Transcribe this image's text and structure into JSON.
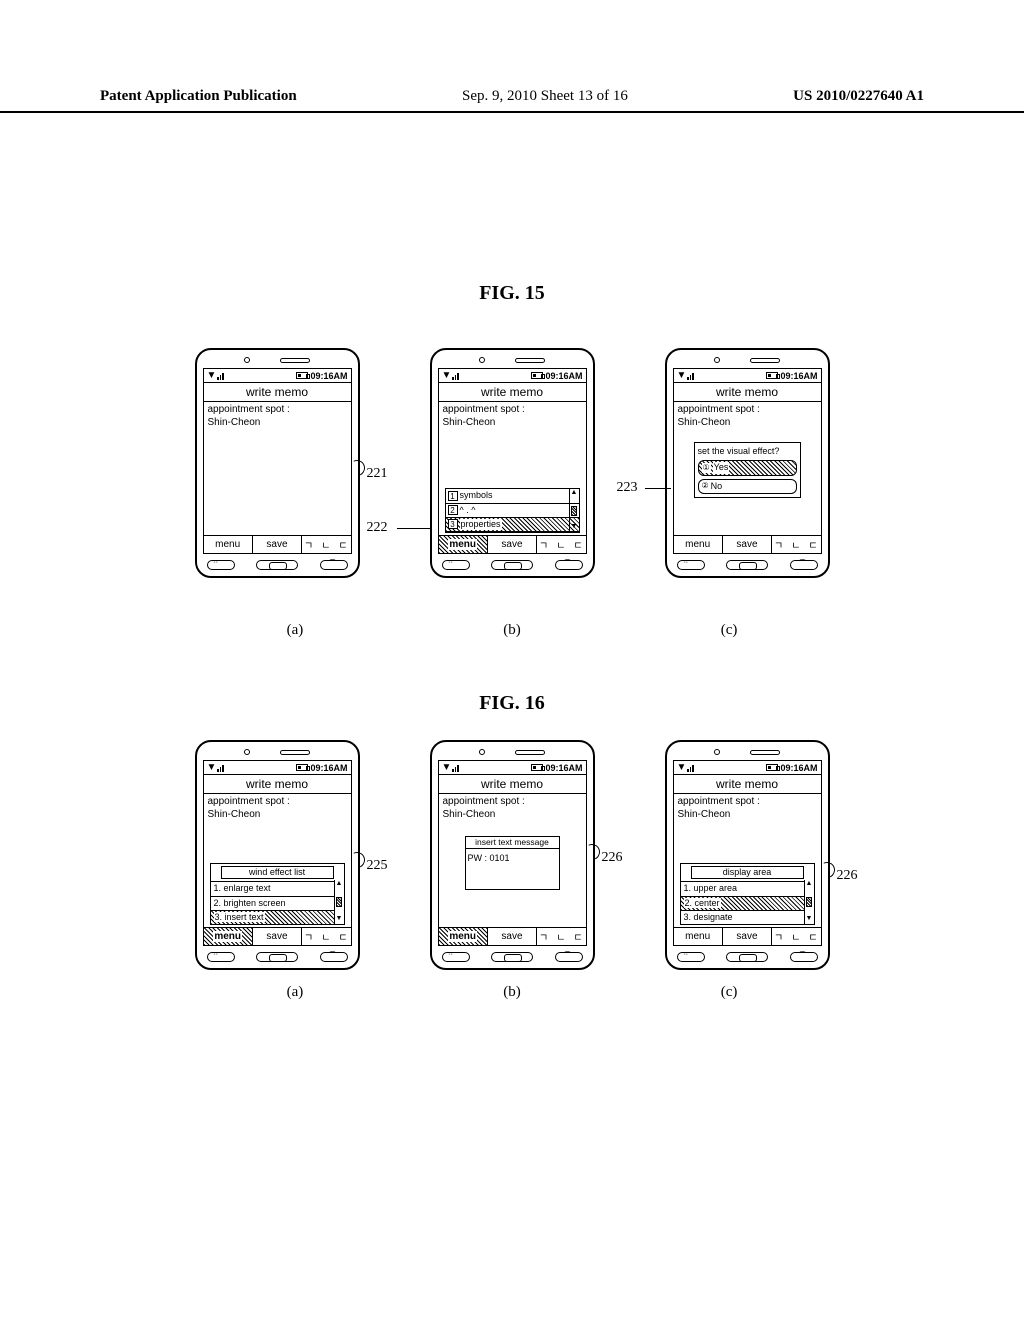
{
  "header": {
    "left": "Patent Application Publication",
    "center": "Sep. 9, 2010  Sheet 13 of 16",
    "right": "US 2010/0227640 A1"
  },
  "fig15": {
    "label": "FIG. 15"
  },
  "fig16": {
    "label": "FIG. 16"
  },
  "common": {
    "time": "09:16AM",
    "title": "write memo",
    "memo_line1": "appointment spot :",
    "memo_line2": "Shin-Cheon",
    "sk_menu": "menu",
    "sk_save": "save",
    "sk_ime": "ㄱ ㄴ ㄷ"
  },
  "callouts": {
    "c221": "221",
    "c222": "222",
    "c223": "223",
    "c225": "225",
    "c226a": "226",
    "c226b": "226"
  },
  "f15b_list": {
    "i1": "symbols",
    "i2": "^ . ^",
    "i3": "properties"
  },
  "f15c_dialog": {
    "q": "set the visual effect?",
    "yes": "Yes",
    "no": "No"
  },
  "f16a_list": {
    "head": "wind effect list",
    "i1": "1. enlarge text",
    "i2": "2. brighten screen",
    "i3": "3. insert text"
  },
  "f16b_dialog": {
    "t": "insert text message",
    "v": "PW : 0101"
  },
  "f16c_list": {
    "head": "display area",
    "i1": "1. upper area",
    "i2": "2. center",
    "i3": "3. designate"
  },
  "subs": {
    "a": "(a)",
    "b": "(b)",
    "c": "(c)"
  }
}
